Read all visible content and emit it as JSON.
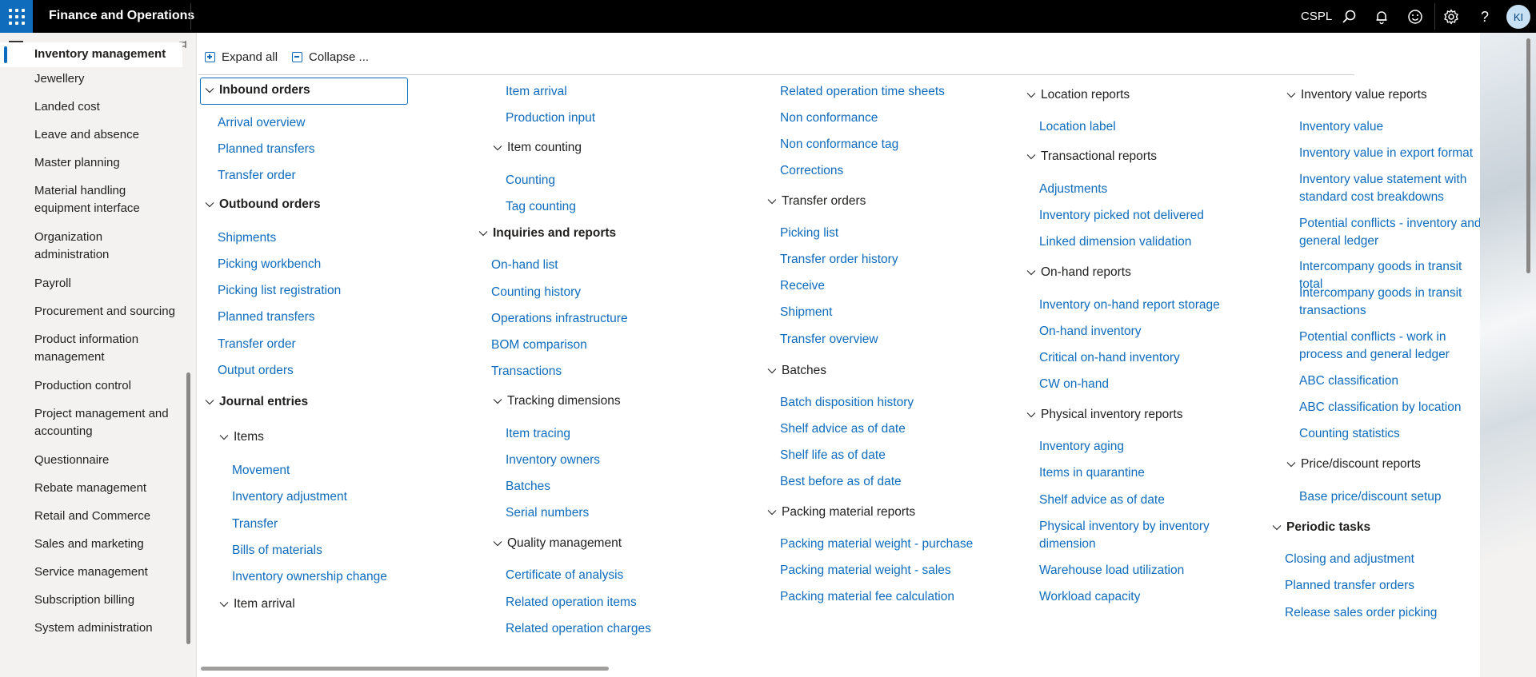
{
  "topbar": {
    "app_title": "Finance and Operations",
    "company": "CSPL",
    "avatar_initials": "KI",
    "icons": [
      "app-launcher-icon",
      "search-icon",
      "bell-icon",
      "smiley-icon",
      "gear-icon",
      "help-icon"
    ]
  },
  "nav": {
    "items": [
      "Inventory management",
      "Jewellery",
      "Landed cost",
      "Leave and absence",
      "Master planning",
      "Material handling equipment interface",
      "Organization administration",
      "Payroll",
      "Procurement and sourcing",
      "Product information management",
      "Production control",
      "Project management and accounting",
      "Questionnaire",
      "Rebate management",
      "Retail and Commerce",
      "Sales and marketing",
      "Service management",
      "Subscription billing",
      "System administration"
    ],
    "active_index": 0
  },
  "toolbar": {
    "expand_all": "Expand all",
    "collapse": "Collapse ..."
  },
  "columns": {
    "c1": {
      "inbound": "Inbound orders",
      "inbound_links": [
        "Arrival overview",
        "Planned transfers",
        "Transfer order"
      ],
      "outbound": "Outbound orders",
      "outbound_links": [
        "Shipments",
        "Picking workbench",
        "Picking list registration",
        "Planned transfers",
        "Transfer order",
        "Output orders"
      ],
      "journal": "Journal entries",
      "items": "Items",
      "items_links": [
        "Movement",
        "Inventory adjustment",
        "Transfer",
        "Bills of materials",
        "Inventory ownership change"
      ],
      "item_arrival": "Item arrival"
    },
    "c2": {
      "top_links": [
        "Item arrival",
        "Production input"
      ],
      "item_counting": "Item counting",
      "counting_links": [
        "Counting",
        "Tag counting"
      ],
      "inquiries": "Inquiries and reports",
      "inquiries_links": [
        "On-hand list",
        "Counting history",
        "Operations infrastructure",
        "BOM comparison",
        "Transactions"
      ],
      "tracking": "Tracking dimensions",
      "tracking_links": [
        "Item tracing",
        "Inventory owners",
        "Batches",
        "Serial numbers"
      ],
      "quality": "Quality management",
      "quality_links": [
        "Certificate of analysis",
        "Related operation items",
        "Related operation charges"
      ]
    },
    "c3": {
      "top_links": [
        "Related operation time sheets",
        "Non conformance",
        "Non conformance tag",
        "Corrections"
      ],
      "transfer": "Transfer orders",
      "transfer_links": [
        "Picking list",
        "Transfer order history",
        "Receive",
        "Shipment",
        "Transfer overview"
      ],
      "batches": "Batches",
      "batches_links": [
        "Batch disposition history",
        "Shelf advice as of date",
        "Shelf life as of date",
        "Best before as of date"
      ],
      "packing": "Packing material reports",
      "packing_links": [
        "Packing material weight - purchase",
        "Packing material weight - sales",
        "Packing material fee calculation"
      ]
    },
    "c4": {
      "location": "Location reports",
      "location_links": [
        "Location label"
      ],
      "transactional": "Transactional reports",
      "transactional_links": [
        "Adjustments",
        "Inventory picked not delivered",
        "Linked dimension validation"
      ],
      "onhand": "On-hand reports",
      "onhand_links": [
        "Inventory on-hand report storage",
        "On-hand inventory",
        "Critical on-hand inventory",
        "CW on-hand"
      ],
      "physical": "Physical inventory reports",
      "physical_links": [
        "Inventory aging",
        "Items in quarantine",
        "Shelf advice as of date",
        "Physical inventory by inventory dimension",
        "Warehouse load utilization",
        "Workload capacity"
      ]
    },
    "c5": {
      "value": "Inventory value reports",
      "value_links": [
        "Inventory value",
        "Inventory value in export format",
        "Inventory value statement with standard cost breakdowns",
        "Potential conflicts - inventory and general ledger",
        "Intercompany goods in transit total",
        "Intercompany goods in transit transactions",
        "Potential conflicts - work in process and general ledger",
        "ABC classification",
        "ABC classification by location",
        "Counting statistics"
      ],
      "price": "Price/discount reports",
      "price_links": [
        "Base price/discount setup"
      ],
      "periodic": "Periodic tasks",
      "periodic_links": [
        "Closing and adjustment",
        "Planned transfer orders",
        "Release sales order picking"
      ]
    }
  }
}
